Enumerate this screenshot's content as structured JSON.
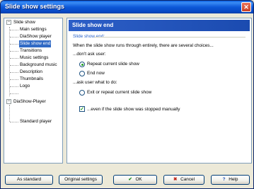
{
  "window": {
    "title": "Slide show settings",
    "close_glyph": "✕"
  },
  "tree": {
    "items": [
      {
        "label": "Slide show",
        "expander": "−"
      },
      {
        "label": "Main settings"
      },
      {
        "label": "DiaShow player"
      },
      {
        "label": "Slide show end"
      },
      {
        "label": "Transitions"
      },
      {
        "label": "Music settings"
      },
      {
        "label": "Background music"
      },
      {
        "label": "Description"
      },
      {
        "label": "Thumbnails"
      },
      {
        "label": "Logo"
      },
      {
        "label": "DiaShow-Player",
        "expander": "−"
      },
      {
        "label": "Standard player"
      }
    ],
    "selected": "Slide show end"
  },
  "panel": {
    "header": "Slide show end",
    "group_title": "Slide show end:",
    "intro": "When the slide show runs through entirely, there are several choices...",
    "section1": "...don't ask user:",
    "opt_repeat": "Repeat current slide show",
    "opt_end": "End now",
    "section2": "...ask user what to do:",
    "opt_exit": "Exit or repeat current slide show",
    "check_manual": "...even if the slide show was stopped manually",
    "selected_option": "Repeat current slide show",
    "check_manual_checked": true
  },
  "buttons": {
    "as_standard": "As standard",
    "original": "Original settings",
    "ok": "OK",
    "cancel": "Cancel",
    "help": "Help",
    "ok_icon": "✔",
    "cancel_icon": "✖",
    "help_icon": "?"
  },
  "colors": {
    "titlebar": "#0A5FE0",
    "panel_header": "#2D5FC7",
    "selection": "#316AC5",
    "group_title": "#2A63C9"
  }
}
